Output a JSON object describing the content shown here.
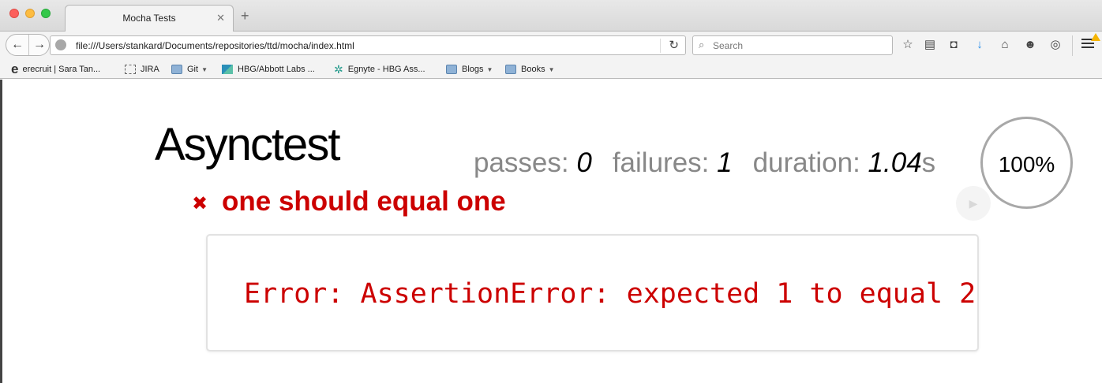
{
  "browser": {
    "tab_title": "Mocha Tests",
    "tab_close": "✕",
    "new_tab": "+",
    "url": "file:///Users/stankard/Documents/repositories/ttd/mocha/index.html",
    "search_placeholder": "Search",
    "bookmarks": [
      {
        "label": "erecruit | Sara Tan...",
        "icon": "erecruit-icon"
      },
      {
        "label": "JIRA",
        "icon": "page-icon"
      },
      {
        "label": "Git",
        "icon": "folder-icon",
        "dropdown": true
      },
      {
        "label": "HBG/Abbott Labs ...",
        "icon": "hbg-icon"
      },
      {
        "label": "Egnyte - HBG Ass...",
        "icon": "egnyte-icon"
      },
      {
        "label": "Blogs",
        "icon": "folder-icon",
        "dropdown": true
      },
      {
        "label": "Books",
        "icon": "folder-icon",
        "dropdown": true
      }
    ]
  },
  "report": {
    "suite_title": "Asynctest",
    "passes_label": "passes:",
    "passes": "0",
    "failures_label": "failures:",
    "failures": "1",
    "duration_label": "duration:",
    "duration": "1.04",
    "duration_unit": "s",
    "progress": "100%",
    "progress_value": 1.0,
    "test": {
      "status": "fail",
      "mark": "✖",
      "title": "one should equal one",
      "error": "Error: AssertionError: expected 1 to equal 2"
    },
    "colors": {
      "fail": "#cc0000",
      "muted": "#888888"
    }
  }
}
